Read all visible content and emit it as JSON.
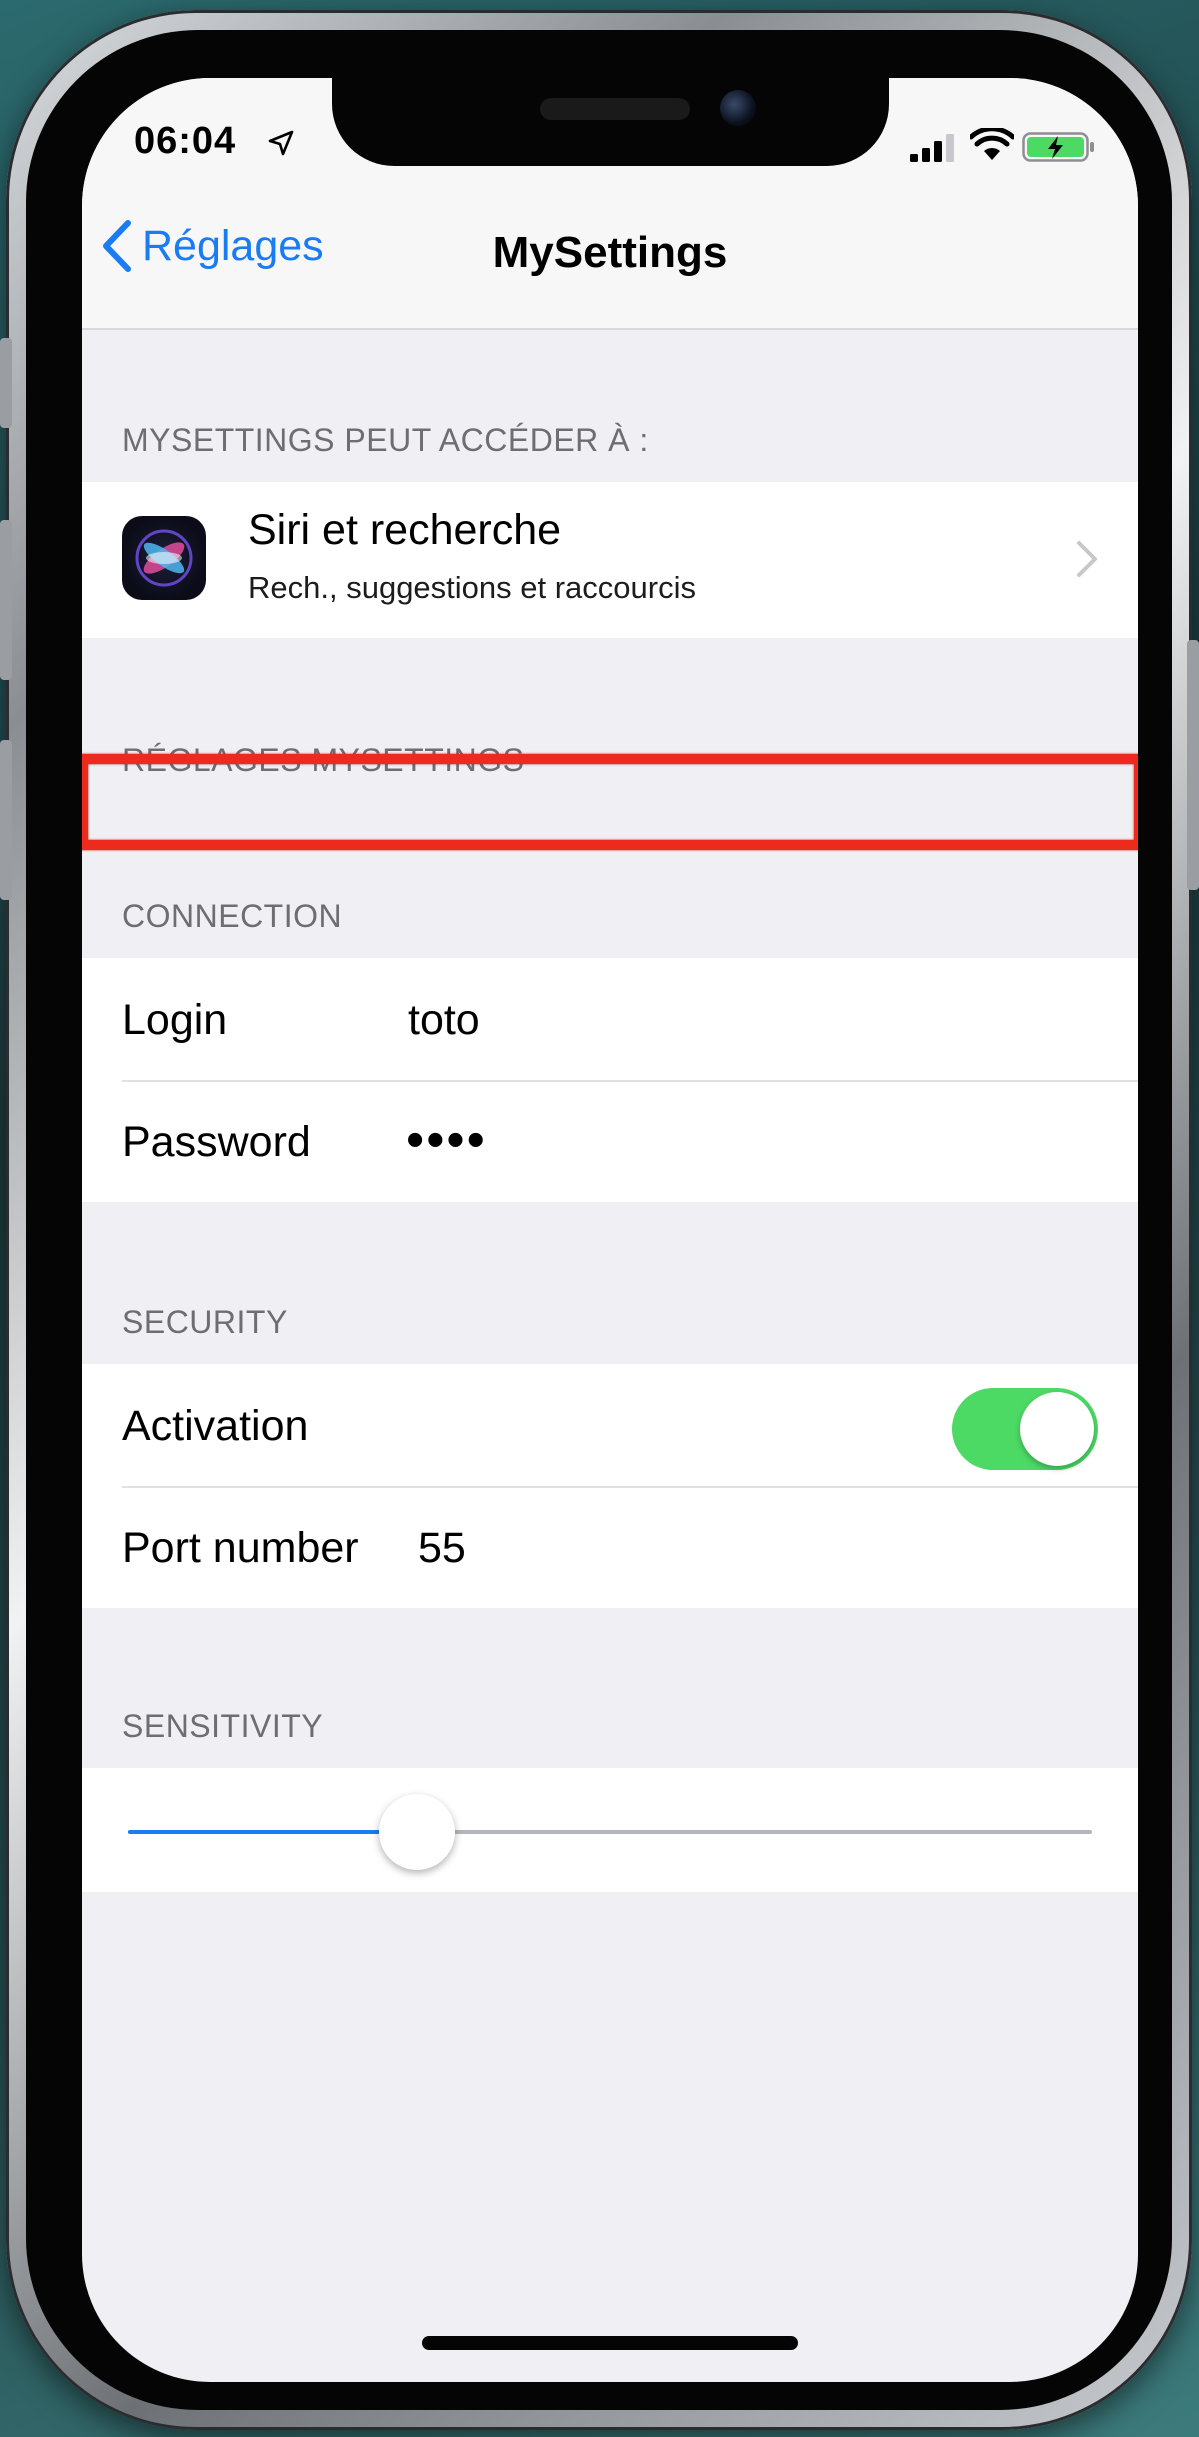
{
  "status_bar": {
    "time": "06:04",
    "icons": [
      "location-arrow-icon",
      "cellular-signal-icon",
      "wifi-icon",
      "battery-charging-icon"
    ]
  },
  "nav": {
    "back_label": "Réglages",
    "title": "MySettings"
  },
  "access_section": {
    "header": "MYSETTINGS PEUT ACCÉDER À :",
    "siri": {
      "title": "Siri et recherche",
      "subtitle": "Rech., suggestions et raccourcis",
      "icon": "siri-icon"
    }
  },
  "app_settings_header": "RÉGLAGES MYSETTINGS",
  "connection": {
    "header": "CONNECTION",
    "login_label": "Login",
    "login_value": "toto",
    "password_label": "Password",
    "password_value": "••••"
  },
  "security": {
    "header": "SECURITY",
    "activation_label": "Activation",
    "activation_on": true,
    "port_label": "Port number",
    "port_value": "55"
  },
  "sensitivity": {
    "header": "SENSITIVITY",
    "value": 0.3
  },
  "colors": {
    "accent": "#1a7cf2",
    "toggle_on": "#4cd964",
    "highlight": "#ee2a1c",
    "background": "#efeff4"
  }
}
